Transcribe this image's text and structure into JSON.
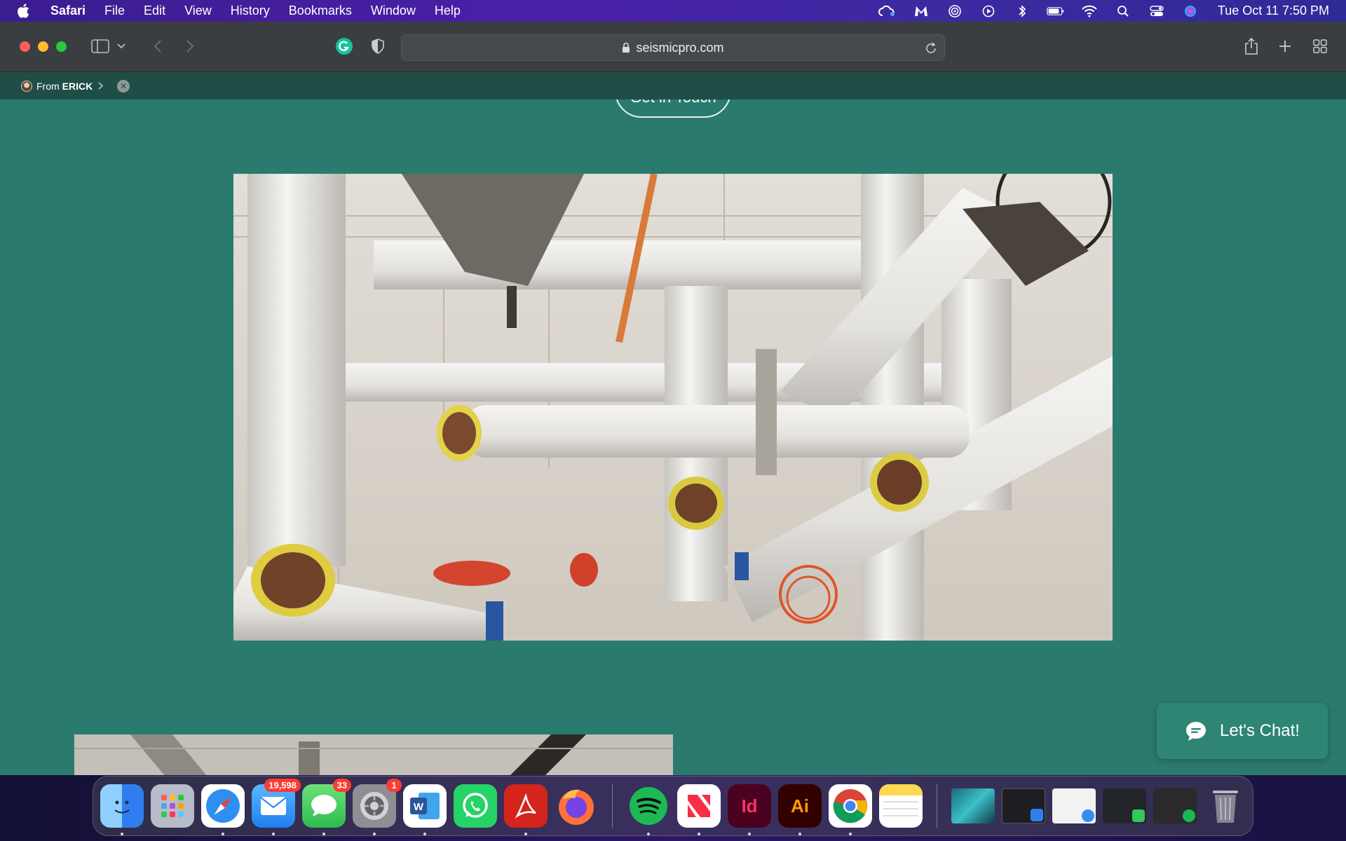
{
  "menubar": {
    "app_name": "Safari",
    "items": [
      "File",
      "Edit",
      "View",
      "History",
      "Bookmarks",
      "Window",
      "Help"
    ],
    "status_icons": [
      "creative-cloud-icon",
      "malwarebytes-icon",
      "airdrop-icon",
      "play-icon",
      "bluetooth-icon",
      "battery-icon",
      "wifi-icon",
      "spotlight-search-icon",
      "control-center-icon",
      "siri-icon"
    ],
    "clock": "Tue Oct 11  7:50 PM"
  },
  "toolbar": {
    "url": "seismicpro.com"
  },
  "shared": {
    "from_label": "From",
    "from_name": "ERICK"
  },
  "page": {
    "cta_label": "Get in Touch",
    "chat_label": "Let's Chat!"
  },
  "dock": {
    "apps": [
      {
        "name": "Finder",
        "icon": "finder-icon",
        "color": "#3a8ef0",
        "running": true
      },
      {
        "name": "Launchpad",
        "icon": "launchpad-icon",
        "color": "#9aa0b5",
        "running": false
      },
      {
        "name": "Safari",
        "icon": "safari-icon",
        "color": "#2f8ff0",
        "running": true
      },
      {
        "name": "Mail",
        "icon": "mail-icon",
        "color": "#4aa3f5",
        "badge": "19,598",
        "running": true
      },
      {
        "name": "Messages",
        "icon": "messages-icon",
        "color": "#34c759",
        "badge": "33",
        "running": true
      },
      {
        "name": "System Preferences",
        "icon": "system-preferences-icon",
        "color": "#8e8e93",
        "badge": "1",
        "running": true
      },
      {
        "name": "Word",
        "icon": "word-icon",
        "color": "#2b579a",
        "running": true
      },
      {
        "name": "WhatsApp",
        "icon": "whatsapp-icon",
        "color": "#25d366",
        "running": false
      },
      {
        "name": "Acrobat",
        "icon": "acrobat-icon",
        "color": "#d4241b",
        "running": true
      },
      {
        "name": "Firefox",
        "icon": "firefox-icon",
        "color": "#ff7139",
        "running": false
      },
      {
        "name": "Spotify",
        "icon": "spotify-icon",
        "color": "#1db954",
        "running": true
      },
      {
        "name": "News",
        "icon": "news-icon",
        "color": "#ffffff",
        "running": true
      },
      {
        "name": "InDesign",
        "icon": "indesign-icon",
        "color": "#49021f",
        "label": "Id",
        "running": true
      },
      {
        "name": "Illustrator",
        "icon": "illustrator-icon",
        "color": "#330000",
        "label": "Ai",
        "running": true
      },
      {
        "name": "Chrome",
        "icon": "chrome-icon",
        "color": "#ffffff",
        "running": true
      },
      {
        "name": "Notes",
        "icon": "notes-icon",
        "color": "#fed84e",
        "running": true
      }
    ],
    "recent": [
      "downloads-stack",
      "window-thumb-1",
      "window-thumb-2",
      "window-thumb-3",
      "window-thumb-4"
    ],
    "trash": "trash-icon"
  }
}
